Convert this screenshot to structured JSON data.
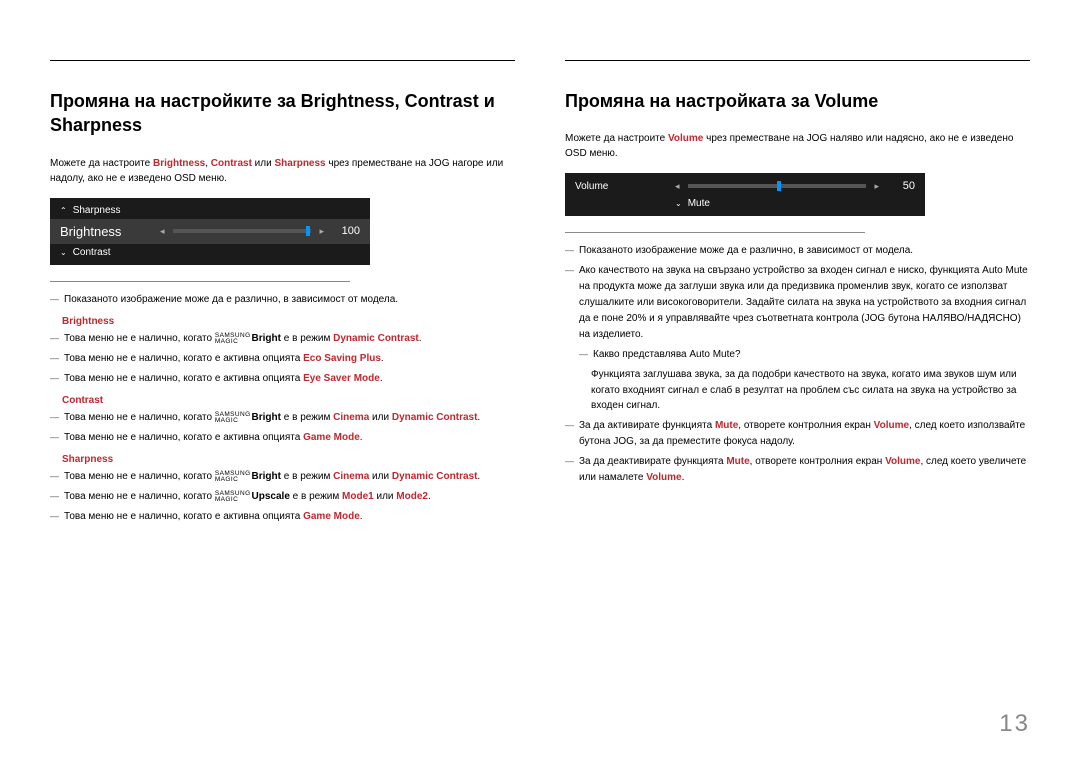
{
  "page_number": "13",
  "left": {
    "heading": "Промяна на настройките за Brightness, Contrast и Sharpness",
    "intro_pre": "Можете да настроите ",
    "intro_kw1": "Brightness",
    "intro_sep1": ", ",
    "intro_kw2": "Contrast",
    "intro_sep2": " или ",
    "intro_kw3": "Sharpness",
    "intro_post": " чрез преместване на JOG нагоре или надолу, ако не е изведено OSD меню.",
    "osd": {
      "up": "Sharpness",
      "focus": "Brightness",
      "down": "Contrast",
      "value": "100"
    },
    "note_model": "Показаното изображение може да е различно, в зависимост от модела.",
    "brightness": {
      "label": "Brightness",
      "n1_pre": "Това меню не е налично, когато ",
      "n1_b": "Bright",
      "n1_mid": " е в режим ",
      "n1_kw": "Dynamic Contrast",
      "n1_post": ".",
      "n2_pre": "Това меню не е налично, когато е активна опцията ",
      "n2_kw": "Eco Saving Plus",
      "n2_post": ".",
      "n3_pre": "Това меню не е налично, когато е активна опцията ",
      "n3_kw": "Eye Saver Mode",
      "n3_post": "."
    },
    "contrast": {
      "label": "Contrast",
      "n1_pre": "Това меню не е налично, когато ",
      "n1_b": "Bright",
      "n1_mid": " е в режим ",
      "n1_kw1": "Cinema",
      "n1_sep": " или ",
      "n1_kw2": "Dynamic Contrast",
      "n1_post": ".",
      "n2_pre": "Това меню не е налично, когато е активна опцията ",
      "n2_kw": "Game Mode",
      "n2_post": "."
    },
    "sharpness": {
      "label": "Sharpness",
      "n1_pre": "Това меню не е налично, когато ",
      "n1_b": "Bright",
      "n1_mid": " е в режим ",
      "n1_kw1": "Cinema",
      "n1_sep": " или ",
      "n1_kw2": "Dynamic Contrast",
      "n1_post": ".",
      "n2_pre": "Това меню не е налично, когато ",
      "n2_b": "Upscale",
      "n2_mid": " е в режим ",
      "n2_kw1": "Mode1",
      "n2_sep": " или ",
      "n2_kw2": "Mode2",
      "n2_post": ".",
      "n3_pre": "Това меню не е налично, когато е активна опцията ",
      "n3_kw": "Game Mode",
      "n3_post": "."
    }
  },
  "right": {
    "heading": "Промяна на настройката за Volume",
    "intro_pre": "Можете да настроите ",
    "intro_kw": "Volume",
    "intro_post": " чрез преместване на JOG наляво или надясно, ако не е изведено OSD меню.",
    "osd": {
      "focus": "Volume",
      "down": "Mute",
      "value": "50"
    },
    "note_model": "Показаното изображение може да е различно, в зависимост от модела.",
    "n1": "Ако качеството на звука на свързано устройство за входен сигнал е ниско, функцията Auto Mute на продукта може да заглуши звука или да предизвика променлив звук, когато се използват слушалките или високоговорители. Задайте силата на звука на устройството за входния сигнал да е поне 20% и я управлявайте чрез съответната контрола (JOG бутона НАЛЯВО/НАДЯСНО) на изделието.",
    "n1s_q": "Какво представлява Auto Mute?",
    "n1s_a": "Функцията заглушава звука, за да подобри качеството на звука, когато има звуков шум или когато входният сигнал е слаб в резултат на проблем със силата на звука на устройство за входен сигнал.",
    "n2_pre": "За да активирате функцията ",
    "n2_kw1": "Mute",
    "n2_mid": ", отворете контролния екран ",
    "n2_kw2": "Volume",
    "n2_post": ", след което използвайте бутона JOG, за да преместите фокуса надолу.",
    "n3_pre": "За да деактивирате функцията ",
    "n3_kw1": "Mute",
    "n3_mid1": ", отворете контролния екран ",
    "n3_kw2": "Volume",
    "n3_mid2": ", след което увеличете или намалете ",
    "n3_kw3": "Volume",
    "n3_post": "."
  },
  "magic": {
    "top": "SAMSUNG",
    "bot": "MAGIC"
  }
}
